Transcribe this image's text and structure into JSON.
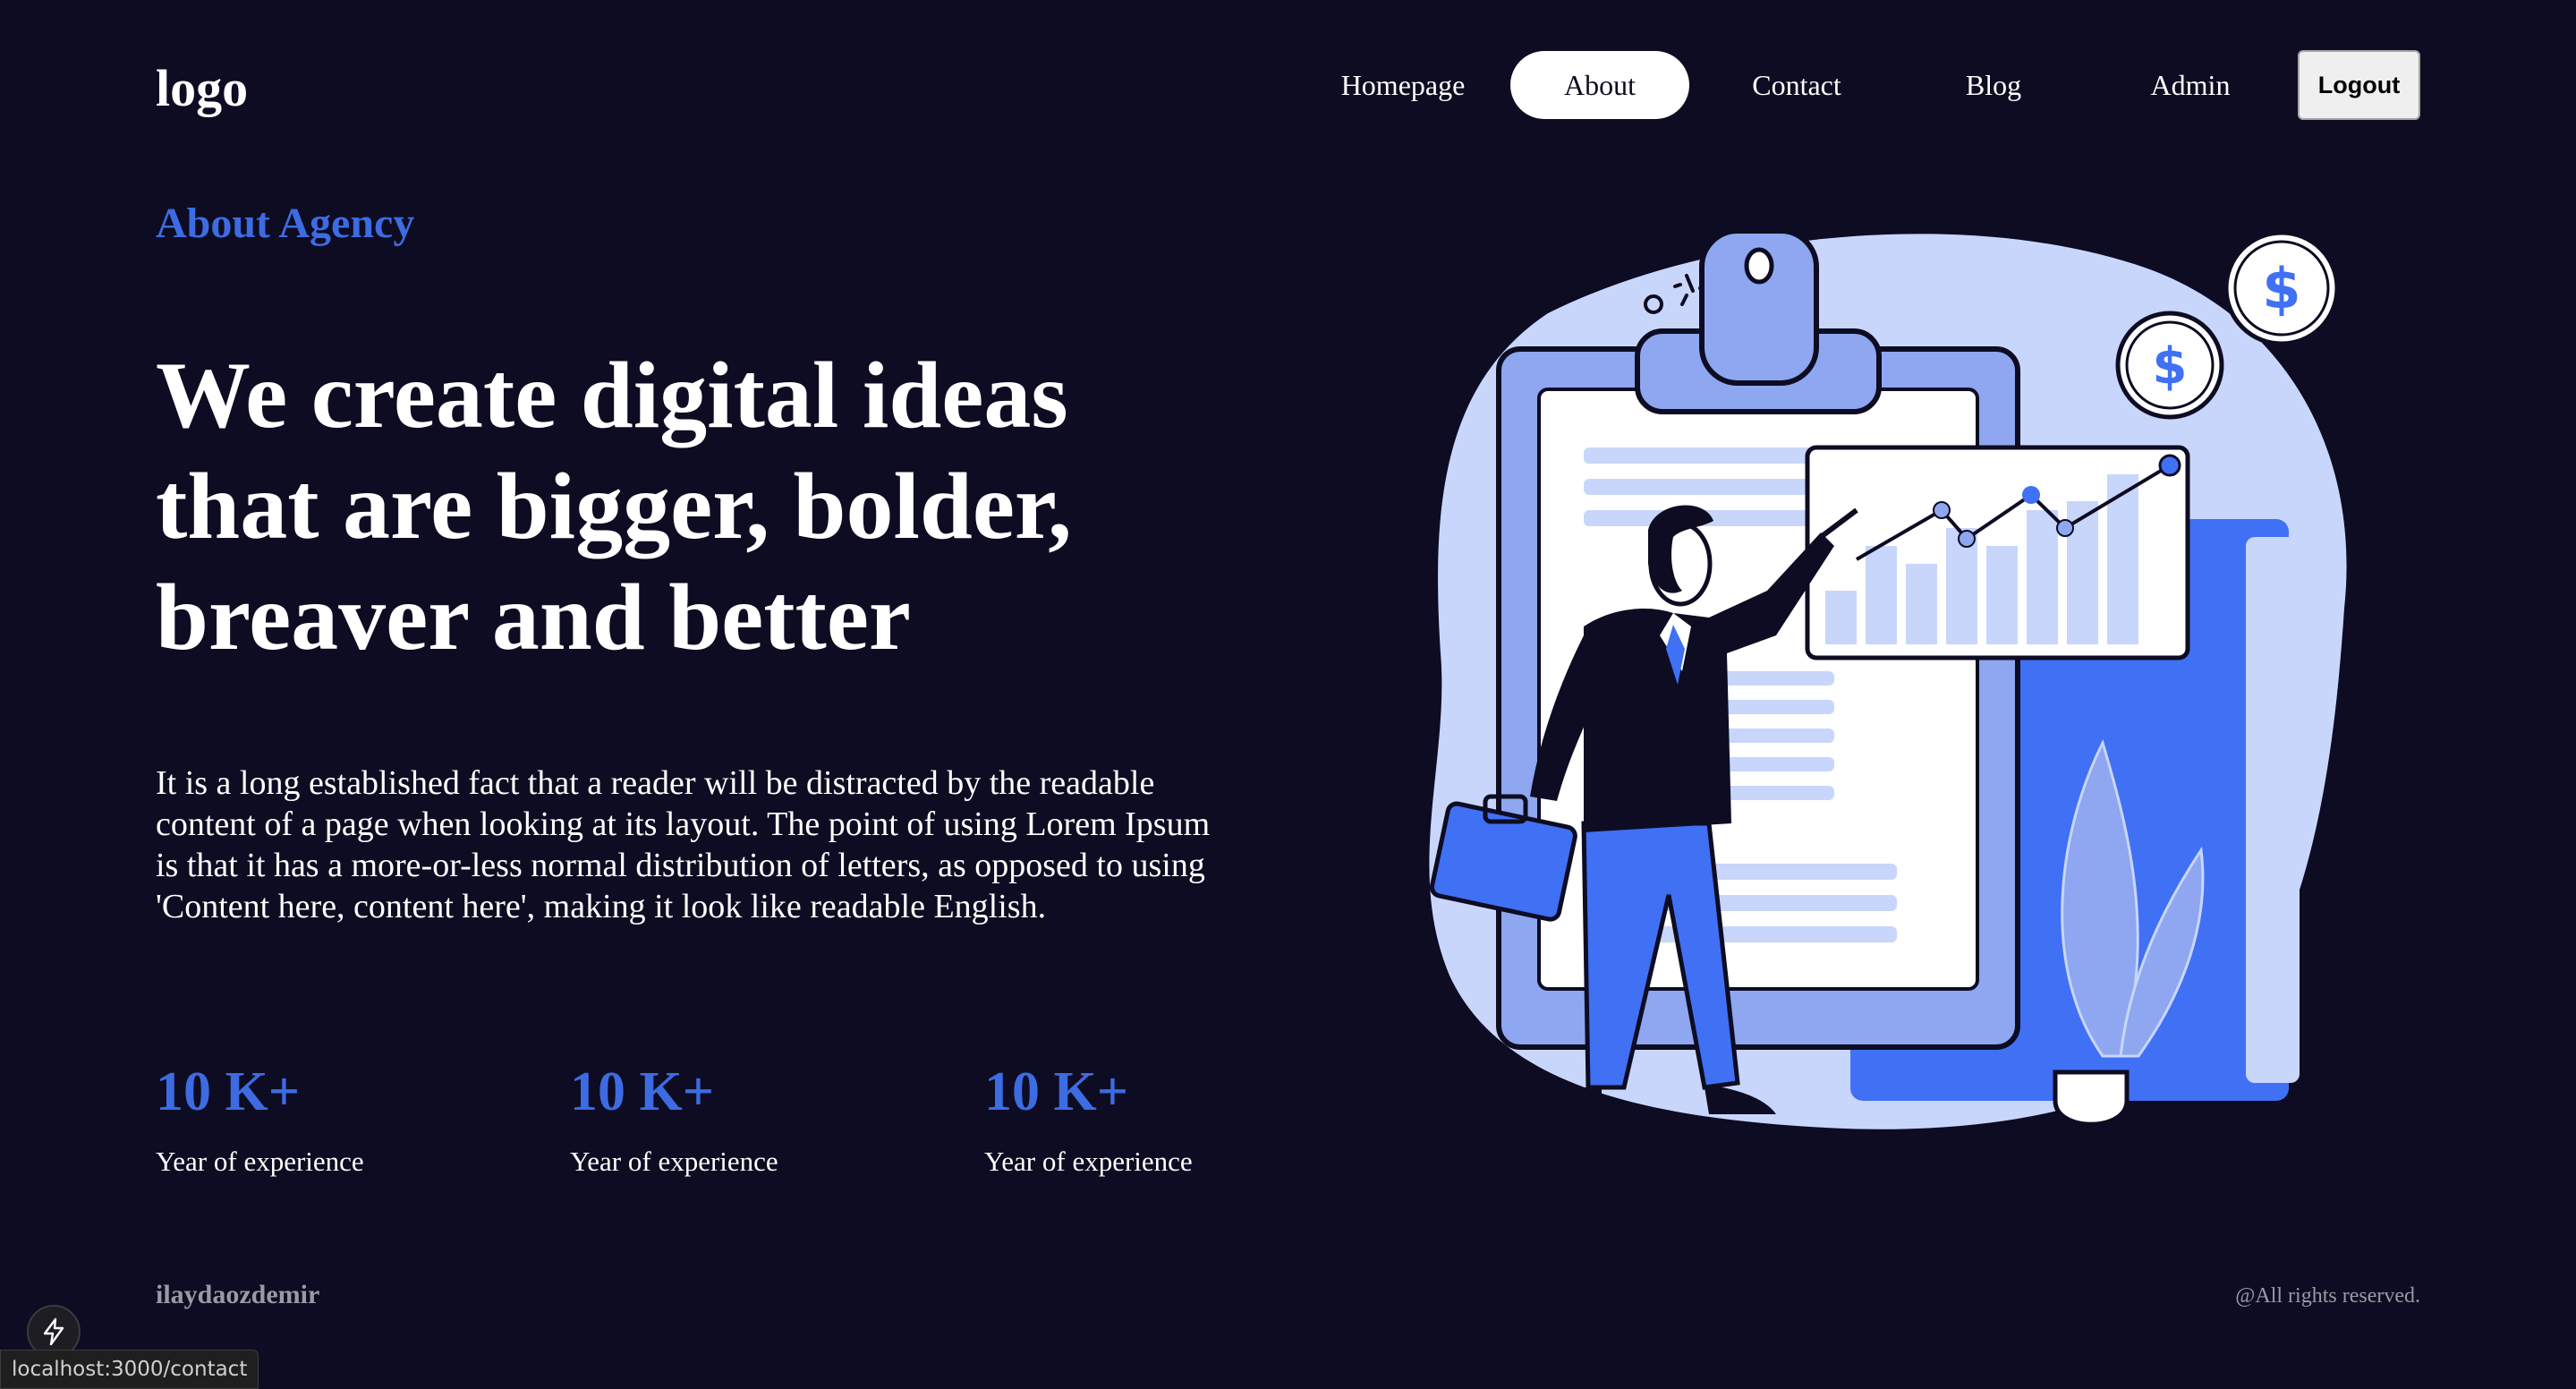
{
  "nav": {
    "logo": "logo",
    "links": [
      {
        "label": "Homepage"
      },
      {
        "label": "About",
        "active": true
      },
      {
        "label": "Contact"
      },
      {
        "label": "Blog"
      },
      {
        "label": "Admin"
      }
    ],
    "logout_label": "Logout"
  },
  "hero": {
    "eyebrow": "About Agency",
    "headline_lines": [
      "We create digital ideas",
      "that are bigger, bolder,",
      "breaver and better"
    ],
    "description": "It is a long established fact that a reader will be distracted by the readable content of a page when looking at its layout. The point of using Lorem Ipsum is that it has a more-or-less normal distribution of letters, as opposed to using 'Content here, content here', making it look like readable English."
  },
  "stats": [
    {
      "value": "10 K+",
      "label": "Year of experience"
    },
    {
      "value": "10 K+",
      "label": "Year of experience"
    },
    {
      "value": "10 K+",
      "label": "Year of experience"
    }
  ],
  "footer": {
    "name": "ilaydaozdemir",
    "copyright": "@All rights reserved."
  },
  "status_bar": {
    "url": "localhost:3000/contact"
  },
  "icons": {
    "dev_indicator": "lightning-bolt-icon",
    "coin": "dollar-coin-icon"
  },
  "colors": {
    "background": "#0d0c22",
    "accent": "#3d6be2",
    "illustration_light": "#c9d6fb",
    "illustration_mid": "#8ea7f0",
    "illustration_blue": "#4070f4"
  }
}
